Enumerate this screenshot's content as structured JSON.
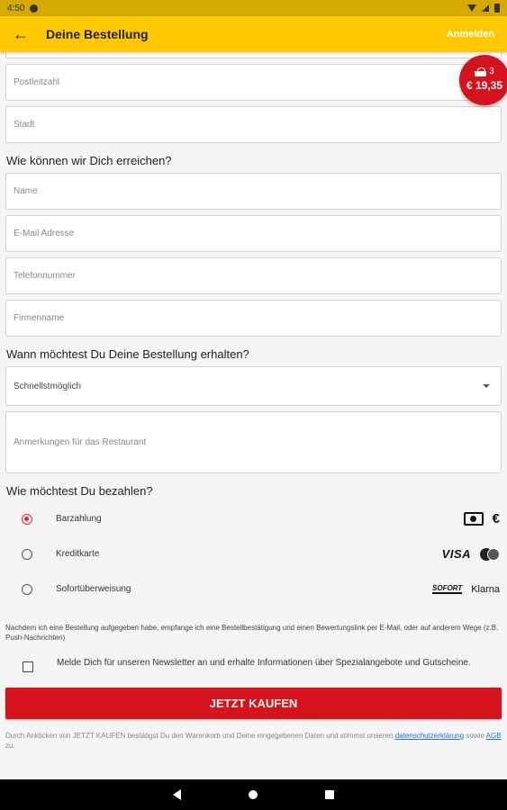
{
  "status_bar": {
    "time": "4:50",
    "icons": [
      "settings-icon",
      "wifi-icon",
      "signal-icon",
      "battery-icon"
    ]
  },
  "app_bar": {
    "title": "Deine Bestellung",
    "login_label": "Anmelden",
    "back_icon": "arrow-left-icon"
  },
  "cart": {
    "count": "3",
    "total": "€ 19,35",
    "icon": "basket-icon",
    "color": "#d6121c"
  },
  "address": {
    "zip_placeholder": "Postleitzahl",
    "city_placeholder": "Stadt"
  },
  "contact": {
    "title": "Wie können wir Dich erreichen?",
    "name_placeholder": "Name",
    "email_placeholder": "E-Mail Adresse",
    "phone_placeholder": "Telefonnummer",
    "company_placeholder": "Firmenname"
  },
  "delivery": {
    "title": "Wann möchtest Du Deine Bestellung erhalten?",
    "selected_time": "Schnellstmöglich",
    "notes_placeholder": "Anmerkungen für das Restaurant"
  },
  "payment": {
    "title": "Wie möchtest Du bezahlen?",
    "options": [
      {
        "label": "Barzahlung",
        "selected": true
      },
      {
        "label": "Kreditkarte",
        "selected": false
      },
      {
        "label": "Sofortüberweisung",
        "selected": false
      }
    ],
    "visa_text": "VISA",
    "sofort_text": "SOFORT",
    "klarna_text": "Klarna"
  },
  "notice": "Nachdem ich eine Bestellung aufgegeben habe, empfange ich eine Bestellbestätigung und einen Bewertungslink per E-Mail, oder auf anderem Wege (z.B. Push-Nachrichten)",
  "newsletter": {
    "label": "Melde Dich für unseren Newsletter an und erhalte Informationen über Spezialangebote und Gutscheine.",
    "checked": false
  },
  "buy_button": {
    "label": "JETZT KAUFEN",
    "color": "#d6121c"
  },
  "legal": {
    "prefix": "Durch Anklicken von JETZT KAUFEN bestätigst Du den Warenkorb und Deine eingegebenen Daten und stimmst unseren",
    "privacy_link": "datenschutzerklärung",
    "middle": "sowie",
    "terms_link": "AGB",
    "suffix": "zu."
  },
  "accent_color": "#ffc800"
}
